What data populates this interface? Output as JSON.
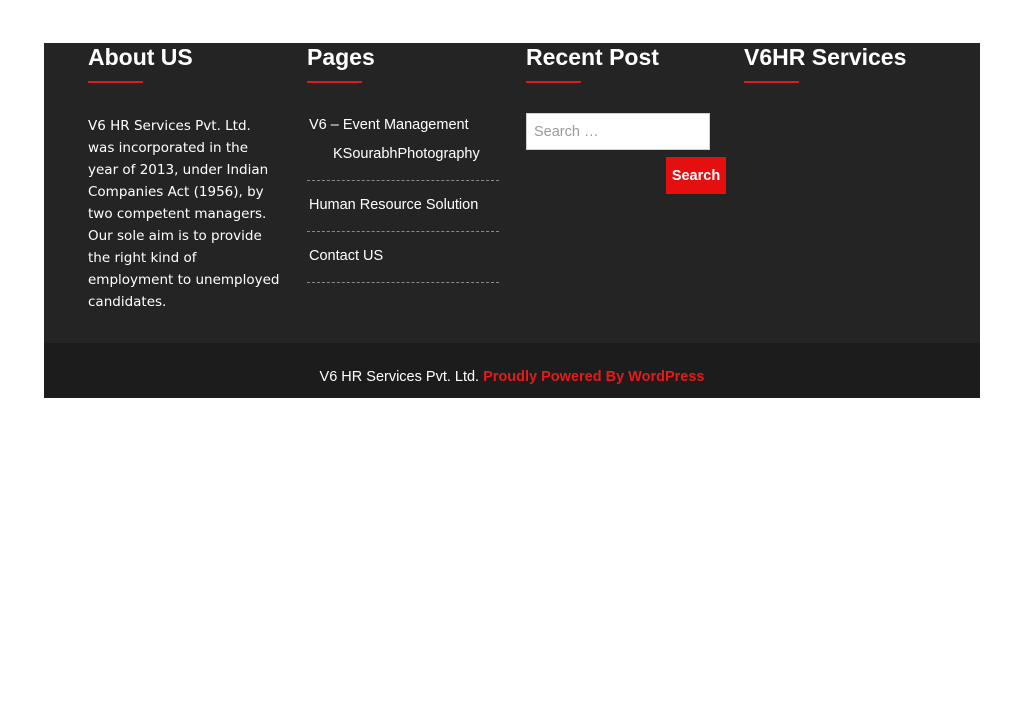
{
  "footer": {
    "about": {
      "title": "About US",
      "text": "V6 HR Services Pvt. Ltd. was incorporated in the year of 2013, under Indian Companies Act (1956), by two competent managers. Our sole aim is to provide the right kind of employment to unemployed candidates."
    },
    "pages": {
      "title": "Pages",
      "items": [
        {
          "label": "V6 – Event Management",
          "sub": "KSourabhPhotography"
        },
        {
          "label": "Human Resource Solution"
        },
        {
          "label": "Contact US"
        }
      ]
    },
    "recent_post": {
      "title": "Recent Post",
      "search_placeholder": "Search …",
      "search_button": "Search"
    },
    "services": {
      "title": "V6HR Services"
    }
  },
  "copyright": {
    "text": "V6 HR Services Pvt. Ltd.",
    "credit": "Proudly Powered By WordPress"
  },
  "colors": {
    "footer_bg": "#242424",
    "copyright_bg": "#1c1c1c",
    "accent": "#e60f0f"
  }
}
